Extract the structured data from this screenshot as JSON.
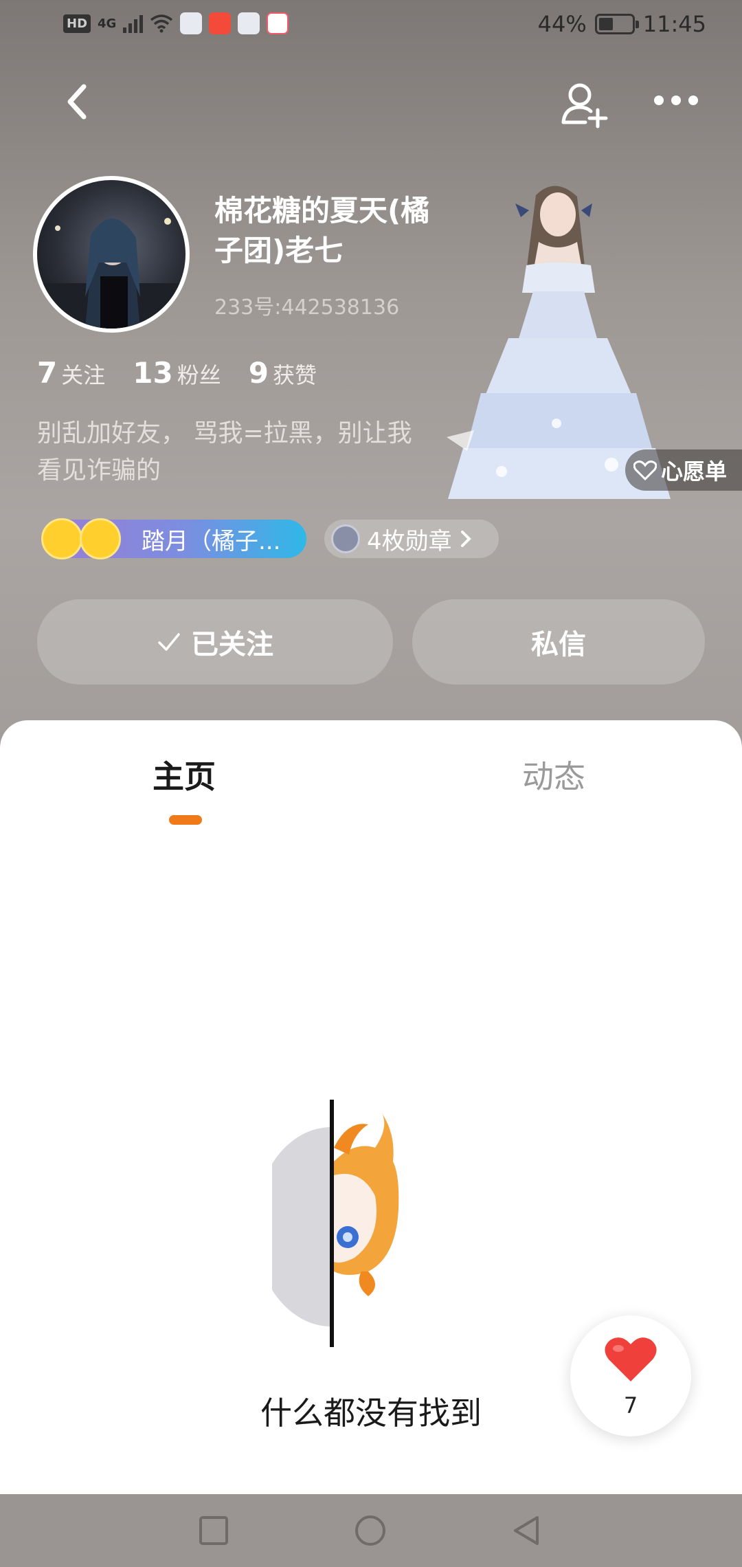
{
  "status_bar": {
    "hd": "HD",
    "network": "4G",
    "battery_percent": "44%",
    "time": "11:45"
  },
  "profile": {
    "name": "棉花糖的夏天(橘子团)老七",
    "uid": "233号:442538136",
    "stats": [
      {
        "value": "7",
        "label": "关注"
      },
      {
        "value": "13",
        "label": "粉丝"
      },
      {
        "value": "9",
        "label": "获赞"
      }
    ],
    "bio": "别乱加好友， 骂我=拉黑，别让我看见诈骗的",
    "wishlist_label": "心愿单",
    "group_badge_label": "踏月（橘子...",
    "medals_label": "4枚勋章"
  },
  "actions": {
    "follow_label": "已关注",
    "message_label": "私信"
  },
  "tabs": [
    {
      "label": "主页",
      "active": true
    },
    {
      "label": "动态",
      "active": false
    }
  ],
  "empty_state": {
    "text": "什么都没有找到"
  },
  "like_button": {
    "count": "7"
  },
  "colors": {
    "accent": "#f07a1a",
    "heart": "#f0403c"
  }
}
